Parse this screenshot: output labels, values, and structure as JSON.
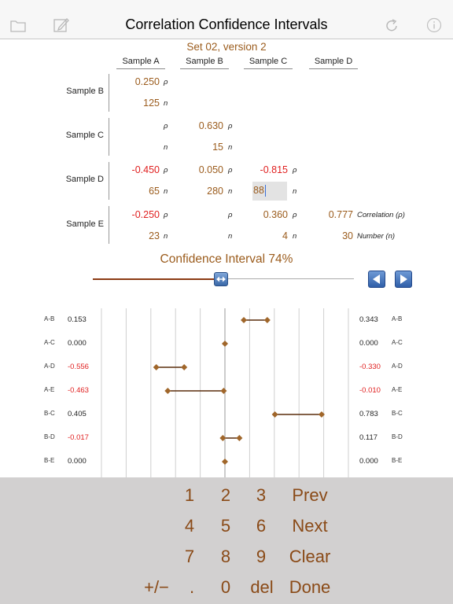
{
  "app": {
    "title": "Correlation Confidence Intervals",
    "icons": [
      "folder-icon",
      "edit-icon",
      "refresh-icon",
      "info-icon"
    ]
  },
  "matrix": {
    "set_label": "Set 02, version 2",
    "columns": [
      "Sample A",
      "Sample B",
      "Sample C",
      "Sample D"
    ],
    "rows": [
      "Sample B",
      "Sample C",
      "Sample D",
      "Sample E"
    ],
    "rho_symbol": "ρ",
    "n_symbol": "n",
    "cells": {
      "BA": {
        "r": "0.250",
        "n": "125"
      },
      "CB": {
        "r": "0.630",
        "n": "15"
      },
      "DA": {
        "r": "-0.450",
        "n": "65"
      },
      "DB": {
        "r": "0.050",
        "n": "280"
      },
      "DC": {
        "r": "-0.815",
        "n": "88"
      },
      "EA": {
        "r": "-0.250",
        "n": "23"
      },
      "EC": {
        "r": "0.360",
        "n": "4"
      },
      "ED": {
        "r": "0.777",
        "n": "30"
      }
    },
    "legend_correlation": "Correlation (ρ)",
    "legend_number": "Number (n)"
  },
  "confidence": {
    "label": "Confidence Interval 74%",
    "level_fraction": 0.49
  },
  "intervals": {
    "x_range": [
      -1,
      1
    ],
    "rows": [
      {
        "pair": "A-B",
        "low": "0.153",
        "high": "0.343",
        "low_v": 0.153,
        "high_v": 0.343
      },
      {
        "pair": "A-C",
        "low": "0.000",
        "high": "0.000",
        "low_v": 0.0,
        "high_v": 0.0
      },
      {
        "pair": "A-D",
        "low": "-0.556",
        "high": "-0.330",
        "low_v": -0.556,
        "high_v": -0.33
      },
      {
        "pair": "A-E",
        "low": "-0.463",
        "high": "-0.010",
        "low_v": -0.463,
        "high_v": -0.01
      },
      {
        "pair": "B-C",
        "low": "0.405",
        "high": "0.783",
        "low_v": 0.405,
        "high_v": 0.783
      },
      {
        "pair": "B-D",
        "low": "-0.017",
        "high": "0.117",
        "low_v": -0.017,
        "high_v": 0.117
      },
      {
        "pair": "B-E",
        "low": "0.000",
        "high": "0.000",
        "low_v": 0.0,
        "high_v": 0.0
      }
    ]
  },
  "keypad": {
    "keys": [
      [
        "1",
        "2",
        "3",
        "Prev"
      ],
      [
        "4",
        "5",
        "6",
        "Next"
      ],
      [
        "7",
        "8",
        "9",
        "Clear"
      ],
      [
        "+/−",
        ".",
        "0",
        "del",
        "Done"
      ]
    ]
  },
  "colors": {
    "accent_brown": "#9b5c1d",
    "negative_red": "#e02020",
    "diamond": "#a0662a",
    "interval_line": "#5a2d0c",
    "nav_button": "#2f5ea8"
  }
}
